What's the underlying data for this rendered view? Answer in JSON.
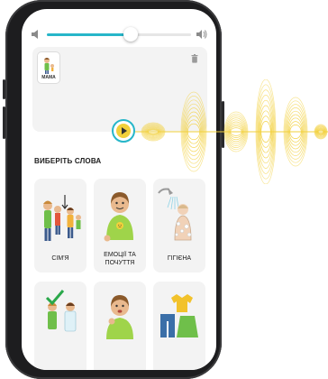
{
  "volume": {
    "level": 0.58,
    "accent": "#27b6c9"
  },
  "sentence": {
    "words": [
      {
        "label": "МАМА"
      }
    ]
  },
  "section_title": "ВИБЕРІТЬ СЛОВА",
  "categories": [
    {
      "label": "СІМ'Я"
    },
    {
      "label_line1": "ЕМОЦІЇ ТА",
      "label_line2": "ПОЧУТТЯ"
    },
    {
      "label": "ГІГІЄНА"
    }
  ],
  "colors": {
    "wave": "#f2d03b",
    "play_ring": "#27b6c9",
    "tile_bg": "#f3f3f3"
  },
  "icons": [
    "speaker-low-icon",
    "speaker-high-icon",
    "trash-icon",
    "play-icon"
  ]
}
